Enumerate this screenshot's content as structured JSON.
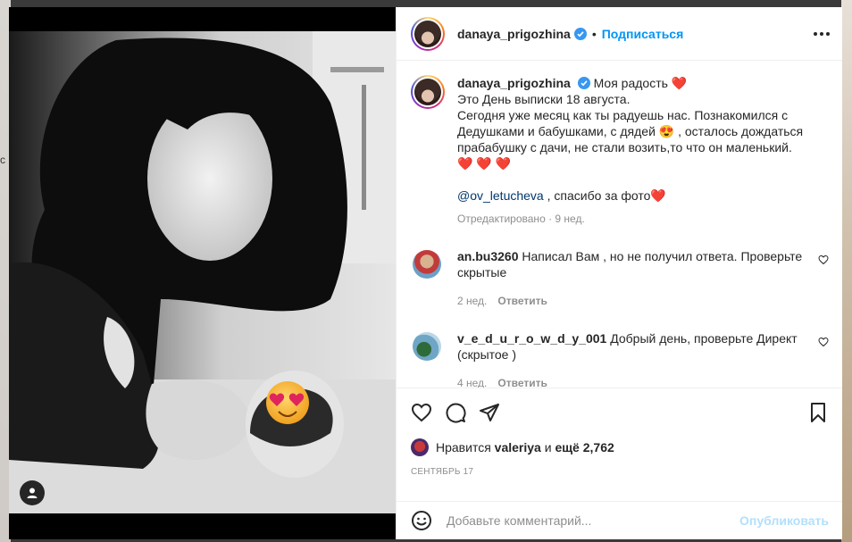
{
  "backdrop": {
    "left_fragment": "с"
  },
  "post": {
    "author": "danaya_prigozhina",
    "separator": "•",
    "follow_label": "Подписаться",
    "caption": {
      "author": "danaya_prigozhina",
      "first_line": "Моя радость",
      "heart": "❤️",
      "lines": [
        "Это День выписки 18 августа.",
        "Сегодня уже месяц как ты радуешь нас. Познакомился с Дедушками и бабушками, с дядей 😍 , осталось дождаться прабабушку с дачи, не стали возить,то что он маленький."
      ],
      "hearts_line": "❤️ ❤️ ❤️",
      "mention": "@ov_letucheva",
      "thanks": " , спасибо за фото❤️",
      "edited": "Отредактировано · 9 нед."
    },
    "comments": [
      {
        "user": "an.bu3260",
        "text": "Написал Вам , но не получил ответа. Проверьте скрытые",
        "age": "2 нед.",
        "reply": "Ответить"
      },
      {
        "user": "v_e_d_u_r_o_w_d_y_001",
        "text": "Добрый день, проверьте Директ (скрытое )",
        "age": "4 нед.",
        "reply": "Ответить"
      }
    ],
    "likes": {
      "prefix": "Нравится",
      "user": "valeriya",
      "middle": "и",
      "rest": "ещё 2,762"
    },
    "date": "СЕНТЯБРЬ 17",
    "comment_placeholder": "Добавьте комментарий...",
    "publish_label": "Опубликовать"
  },
  "colors": {
    "accent": "#0095f6",
    "publish_disabled": "#b2dffc",
    "heart": "#e0245e",
    "muted": "#8e8e8e"
  }
}
